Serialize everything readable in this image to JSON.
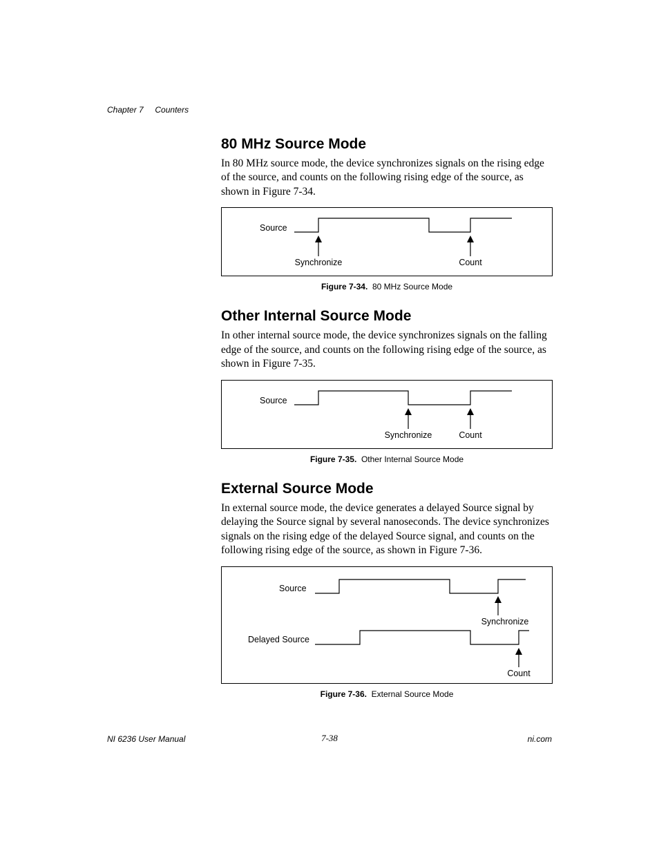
{
  "header": {
    "chapter": "Chapter 7",
    "title": "Counters"
  },
  "sections": [
    {
      "heading": "80 MHz Source Mode",
      "body": "In 80 MHz source mode, the device synchronizes signals on the rising edge of the source, and counts on the following rising edge of the source, as shown in Figure 7-34.",
      "figure": {
        "id": "Figure 7-34.",
        "title": "80 MHz Source Mode",
        "labels": {
          "source": "Source",
          "sync": "Synchronize",
          "count": "Count"
        }
      }
    },
    {
      "heading": "Other Internal Source Mode",
      "body": "In other internal source mode, the device synchronizes signals on the falling edge of the source, and counts on the following rising edge of the source, as shown in Figure 7-35.",
      "figure": {
        "id": "Figure 7-35.",
        "title": "Other Internal Source Mode",
        "labels": {
          "source": "Source",
          "sync": "Synchronize",
          "count": "Count"
        }
      }
    },
    {
      "heading": "External Source Mode",
      "body": "In external source mode, the device generates a delayed Source signal by delaying the Source signal by several nanoseconds. The device synchronizes signals on the rising edge of the delayed Source signal, and counts on the following rising edge of the source, as shown in Figure 7-36.",
      "figure": {
        "id": "Figure 7-36.",
        "title": "External Source Mode",
        "labels": {
          "source": "Source",
          "delayed": "Delayed Source",
          "sync": "Synchronize",
          "count": "Count"
        }
      }
    }
  ],
  "footer": {
    "left": "NI 6236 User Manual",
    "center": "7-38",
    "right": "ni.com"
  }
}
